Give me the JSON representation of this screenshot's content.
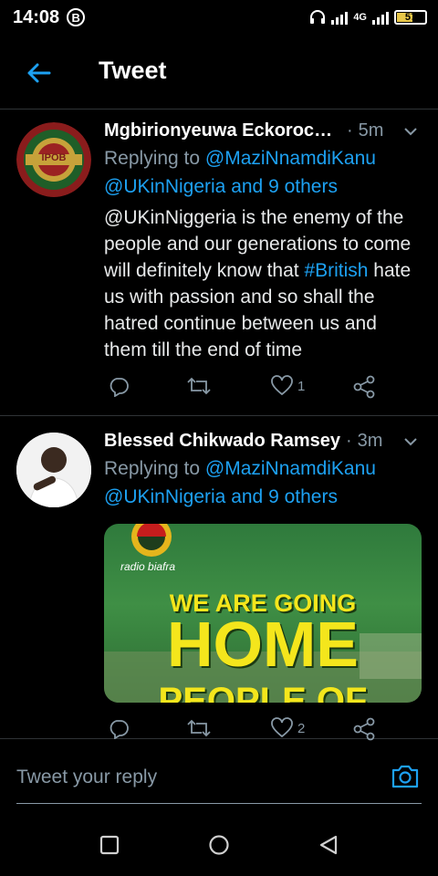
{
  "status_bar": {
    "time": "14:08",
    "app_badge": "B",
    "network": "4G",
    "battery": "57",
    "battery_fraction": 0.57
  },
  "header": {
    "title": "Tweet"
  },
  "tweets": [
    {
      "author": "Mgbirionyeuwa Eckorock ...",
      "time": "5m",
      "reply_prefix": "Replying to",
      "reply_mention_1": "@MaziNnamdiKanu",
      "reply_mention_2": "@UKinNigeria and 9 others",
      "body_part1": "@UKinNiggeria is the enemy of the people and our generations to come will definitely know that ",
      "body_hashtag": "#British",
      "body_part2": " hate us with passion and so shall the hatred continue between us and them till the end of time",
      "likes": "1",
      "avatar_text": "IPOB"
    },
    {
      "author": "Blessed Chikwado Ramsey",
      "time": "3m",
      "reply_prefix": "Replying to",
      "reply_mention_1": "@MaziNnamdiKanu",
      "reply_mention_2": "@UKinNigeria and 9 others",
      "likes": "2",
      "media": {
        "logo_text": "radio biafra",
        "line1": "WE ARE GOING",
        "line2": "HOME",
        "line3": "PEOPLE OF"
      }
    }
  ],
  "reply_box": {
    "placeholder": "Tweet your reply"
  },
  "colors": {
    "accent": "#1da1f2",
    "muted": "#8899a6",
    "background": "#000000"
  }
}
